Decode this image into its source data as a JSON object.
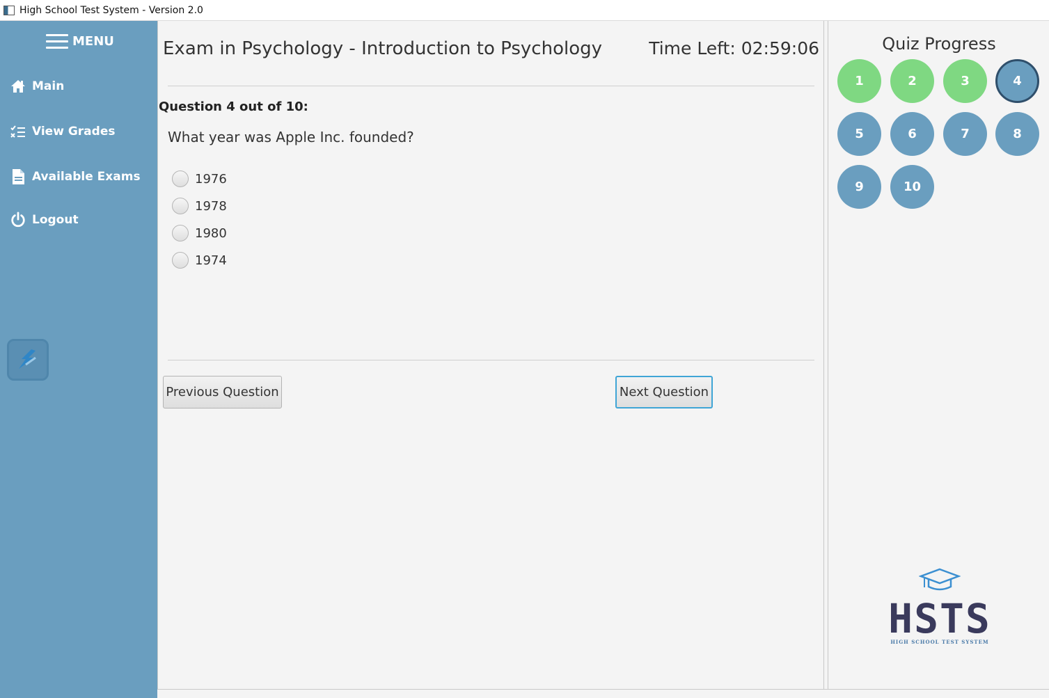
{
  "window": {
    "title": "High School Test System - Version 2.0"
  },
  "sidebar": {
    "menu_label": "MENU",
    "items": [
      {
        "label": "Main",
        "icon": "home-icon"
      },
      {
        "label": "View Grades",
        "icon": "checklist-icon"
      },
      {
        "label": "Available Exams",
        "icon": "document-icon"
      },
      {
        "label": "Logout",
        "icon": "power-icon"
      }
    ]
  },
  "exam": {
    "title": "Exam in Psychology - Introduction to Psychology",
    "timer": "Time Left: 02:59:06",
    "question_count": "Question 4 out of 10:",
    "question_text": "What year was Apple Inc. founded?",
    "options": [
      "1976",
      "1978",
      "1980",
      "1974"
    ],
    "selected_option": null,
    "prev_label": "Previous Question",
    "next_label": "Next Question"
  },
  "progress": {
    "title": "Quiz Progress",
    "questions": [
      {
        "label": "1",
        "state": "done"
      },
      {
        "label": "2",
        "state": "done"
      },
      {
        "label": "3",
        "state": "done"
      },
      {
        "label": "4",
        "state": "current"
      },
      {
        "label": "5",
        "state": "todo"
      },
      {
        "label": "6",
        "state": "todo"
      },
      {
        "label": "7",
        "state": "todo"
      },
      {
        "label": "8",
        "state": "todo"
      },
      {
        "label": "9",
        "state": "todo"
      },
      {
        "label": "10",
        "state": "todo"
      }
    ]
  },
  "logo": {
    "letters": "HSTS",
    "subtitle": "HIGH SCHOOL TEST SYSTEM"
  },
  "colors": {
    "sidebar": "#6a9ebf",
    "done": "#7fd882",
    "todo": "#6a9ebf",
    "current_border": "#2f4f6b",
    "next_border": "#3fa5d6"
  }
}
